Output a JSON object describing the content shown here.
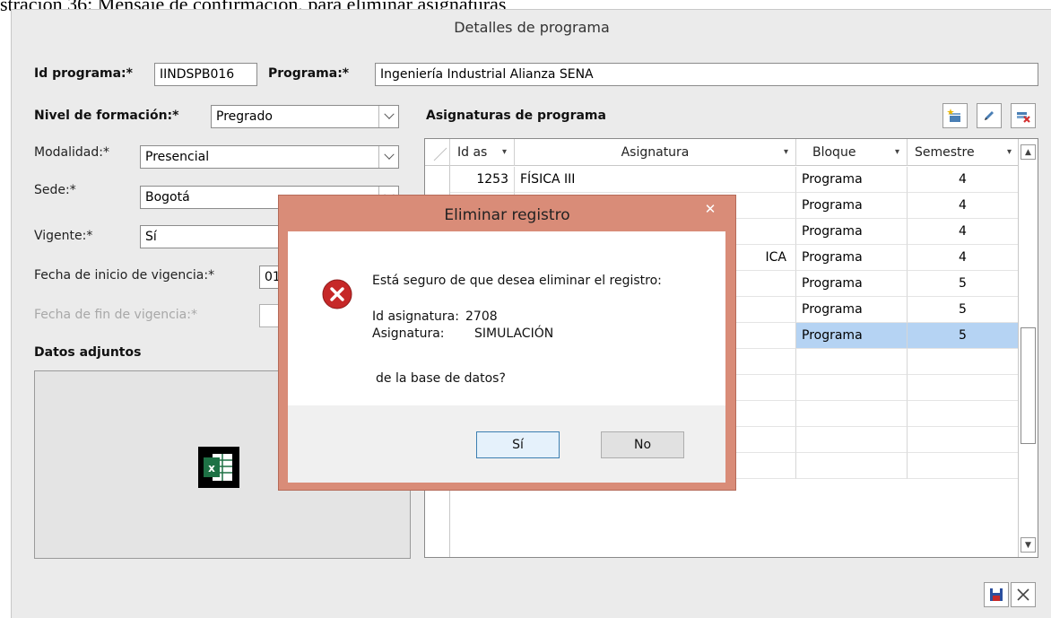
{
  "document": {
    "caption": "stración 36: Mensaje de confirmación, para eliminar asignaturas"
  },
  "window": {
    "title": "Detalles de programa"
  },
  "form": {
    "id_programa_label": "Id programa:*",
    "id_programa_value": "IINDSPB016",
    "programa_label": "Programa:*",
    "programa_value": "Ingeniería Industrial Alianza SENA",
    "nivel_label": "Nivel de formación:*",
    "nivel_value": "Pregrado",
    "modalidad_label": "Modalidad:*",
    "modalidad_value": "Presencial",
    "sede_label": "Sede:*",
    "sede_value": "Bogotá",
    "vigente_label": "Vigente:*",
    "vigente_value": "Sí",
    "fecha_inicio_label": "Fecha de inicio de vigencia:*",
    "fecha_inicio_value": "01",
    "fecha_fin_label": "Fecha de fin de vigencia:*",
    "fecha_fin_value": "",
    "datos_adjuntos_label": "Datos adjuntos"
  },
  "asignaturas": {
    "title": "Asignaturas de programa",
    "toolbar": {
      "add_icon": "add-record-icon",
      "edit_icon": "pencil-icon",
      "delete_icon": "delete-record-icon"
    },
    "columns": [
      "Id as",
      "Asignatura",
      "Bloque",
      "Semestre"
    ],
    "rows": [
      {
        "id": "1253",
        "asignatura": "FÍSICA III",
        "bloque": "Programa",
        "semestre": "4"
      },
      {
        "id": "",
        "asignatura": "",
        "bloque": "Programa",
        "semestre": "4"
      },
      {
        "id": "",
        "asignatura": "",
        "bloque": "Programa",
        "semestre": "4"
      },
      {
        "id": "",
        "asignatura": "ICA",
        "bloque": "Programa",
        "semestre": "4"
      },
      {
        "id": "",
        "asignatura": "",
        "bloque": "Programa",
        "semestre": "5"
      },
      {
        "id": "",
        "asignatura": "",
        "bloque": "Programa",
        "semestre": "5"
      },
      {
        "id": "",
        "asignatura": "",
        "bloque": "Programa",
        "semestre": "5"
      }
    ]
  },
  "dialog": {
    "title": "Eliminar registro",
    "close_glyph": "✕",
    "line1": "Está seguro de que desea eliminar el registro:",
    "id_label": "Id asignatura:",
    "id_value": "2708",
    "asig_label": "Asignatura:",
    "asig_value": "SIMULACIÓN",
    "line3": "de la base de datos?",
    "yes": "Sí",
    "no": "No"
  },
  "colors": {
    "dialog_border": "#d98c78",
    "selected_cell": "#b5d3f3",
    "error_icon": "#c62828"
  }
}
